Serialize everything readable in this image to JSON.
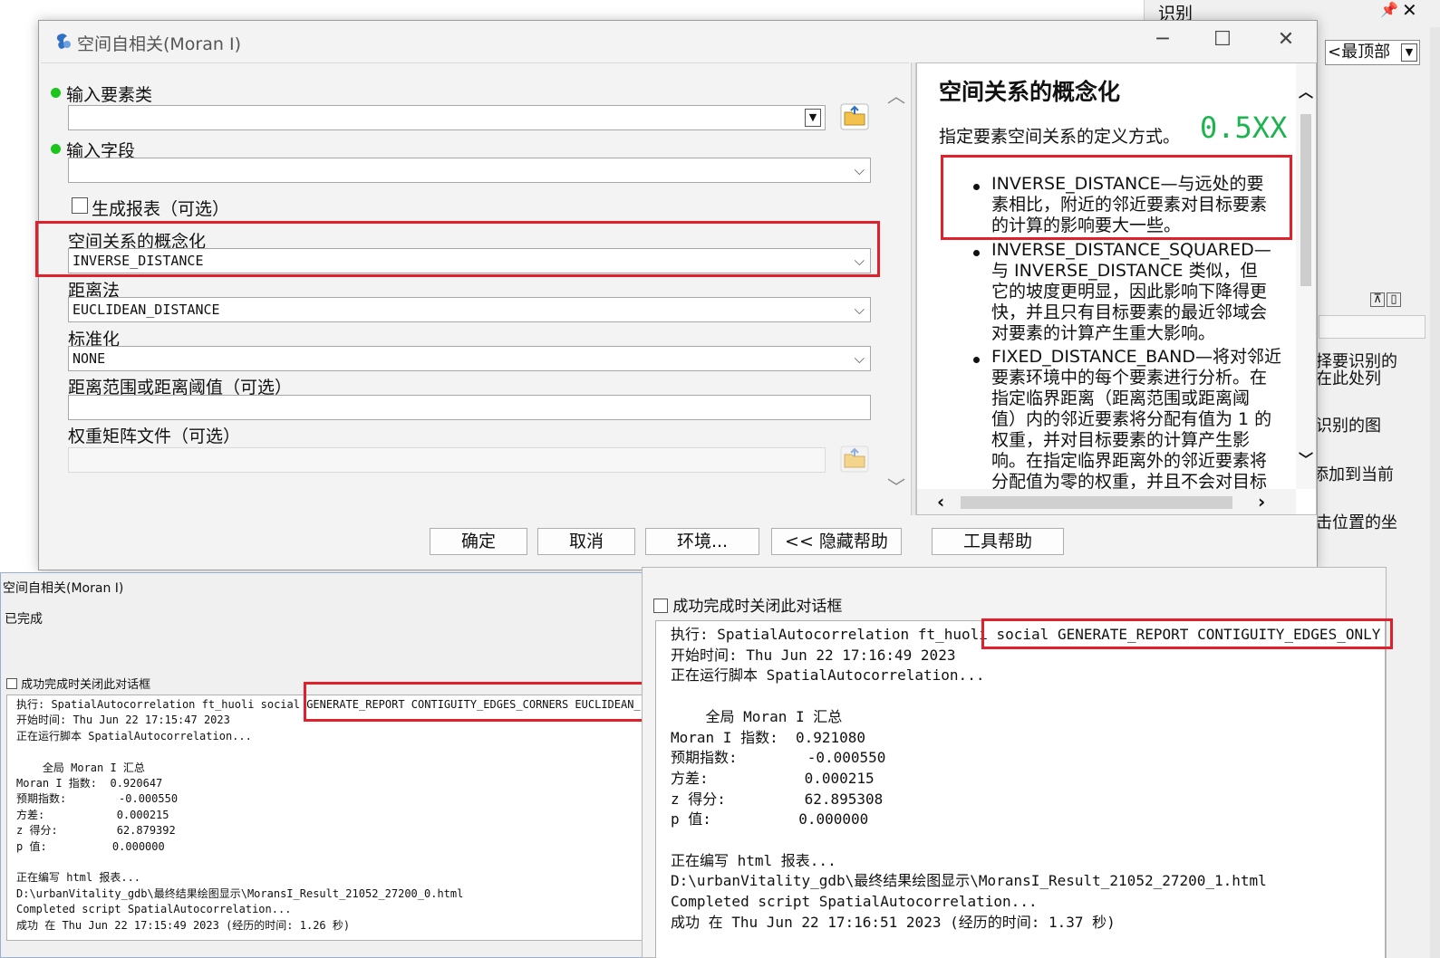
{
  "background_panel": {
    "title": "识别",
    "pin": "ᵖ",
    "close": "✕",
    "layer_combo": "<最顶部",
    "lines": [
      "择要识别的",
      "在此处列",
      "识别的图",
      "添加到当前",
      "击位置的坐"
    ]
  },
  "dialog": {
    "title": "空间自相关(Moran I)",
    "fields": {
      "input_features_label": "输入要素类",
      "input_field_label": "输入字段",
      "generate_report_label": "生成报表（可选）",
      "conceptualization_label": "空间关系的概念化",
      "conceptualization_value": "INVERSE_DISTANCE",
      "distance_method_label": "距离法",
      "distance_method_value": "EUCLIDEAN_DISTANCE",
      "standardization_label": "标准化",
      "standardization_value": "NONE",
      "distance_threshold_label": "距离范围或距离阈值（可选）",
      "weights_file_label": "权重矩阵文件（可选）"
    },
    "help": {
      "heading": "空间关系的概念化",
      "intro": "指定要素空间关系的定义方式。",
      "overlay": "0.5XX",
      "bullet1": [
        "INVERSE_DISTANCE—与远处的要",
        "素相比，附近的邻近要素对目标要素",
        "的计算的影响要大一些。"
      ],
      "bullet2": [
        "INVERSE_DISTANCE_SQUARED—",
        "与 INVERSE_DISTANCE 类似，但",
        "它的坡度更明显，因此影响下降得更",
        "快，并且只有目标要素的最近邻域会",
        "对要素的计算产生重大影响。"
      ],
      "bullet3": [
        "FIXED_DISTANCE_BAND—将对邻近",
        "要素环境中的每个要素进行分析。在",
        "指定临界距离（距离范围或距离阈",
        "值）内的邻近要素将分配有值为 1 的",
        "权重，并对目标要素的计算产生影",
        "响。在指定临界距离外的邻近要素将",
        "分配值为零的权重，并且不会对目标"
      ]
    },
    "buttons": {
      "ok": "确定",
      "cancel": "取消",
      "env": "环境...",
      "hide_help": "<< 隐藏帮助",
      "tool_help": "工具帮助"
    }
  },
  "progress_left": {
    "title": "空间自相关(Moran I)",
    "status": "已完成",
    "close_on_success": "成功完成时关闭此对话框",
    "log": [
      "执行: SpatialAutocorrelation ft_huoli social GENERATE_REPORT CONTIGUITY_EDGES_CORNERS EUCLIDEAN_",
      "开始时间: Thu Jun 22 17:15:47 2023",
      "正在运行脚本 SpatialAutocorrelation...",
      "",
      "    全局 Moran I 汇总",
      "Moran I 指数:  0.920647",
      "预期指数:        -0.000550",
      "方差:           0.000215",
      "z 得分:         62.879392",
      "p 值:          0.000000",
      "",
      "正在编写 html 报表...",
      "D:\\urbanVitality_gdb\\最终结果绘图显示\\MoransI_Result_21052_27200_0.html",
      "Completed script SpatialAutocorrelation...",
      "成功 在 Thu Jun 22 17:15:49 2023 (经历的时间: 1.26 秒)"
    ]
  },
  "progress_right": {
    "close_on_success": "成功完成时关闭此对话框",
    "log": [
      "执行: SpatialAutocorrelation ft_huoli social GENERATE_REPORT CONTIGUITY_EDGES_ONLY EU",
      "开始时间: Thu Jun 22 17:16:49 2023",
      "正在运行脚本 SpatialAutocorrelation...",
      "",
      "    全局 Moran I 汇总",
      "Moran I 指数:  0.921080",
      "预期指数:        -0.000550",
      "方差:           0.000215",
      "z 得分:         62.895308",
      "p 值:          0.000000",
      "",
      "正在编写 html 报表...",
      "D:\\urbanVitality_gdb\\最终结果绘图显示\\MoransI_Result_21052_27200_1.html",
      "Completed script SpatialAutocorrelation...",
      "成功 在 Thu Jun 22 17:16:51 2023 (经历的时间: 1.37 秒)"
    ]
  },
  "colors": {
    "highlight_red": "#e0212c",
    "required_dot": "#1bc51b",
    "overlay_green": "#1db34f"
  }
}
